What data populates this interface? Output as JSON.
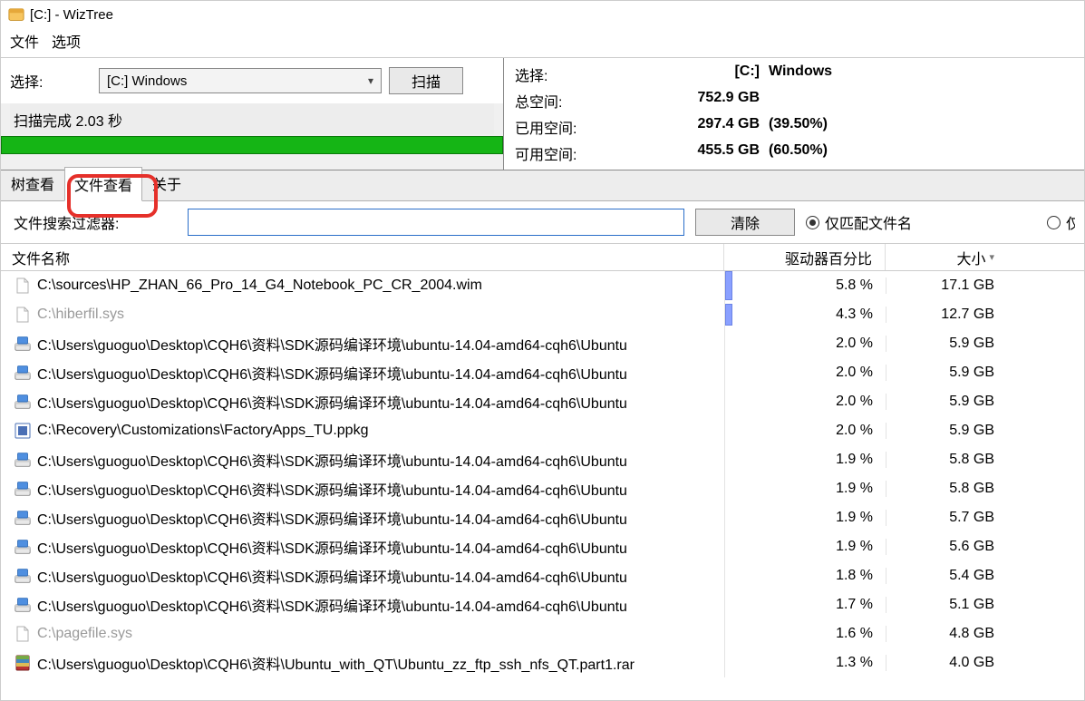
{
  "title": "[C:]  - WizTree",
  "menu": {
    "file": "文件",
    "options": "选项"
  },
  "left": {
    "select_label": "选择:",
    "drive": "[C:] Windows",
    "scan": "扫描",
    "status": "扫描完成 2.03 秒"
  },
  "info": {
    "select_label": "选择:",
    "drive_id": "[C:]",
    "drive_name": "Windows",
    "total_label": "总空间:",
    "total": "752.9 GB",
    "used_label": "已用空间:",
    "used": "297.4 GB",
    "used_pct": "(39.50%)",
    "free_label": "可用空间:",
    "free": "455.5 GB",
    "free_pct": "(60.50%)"
  },
  "tabs": {
    "tree": "树查看",
    "file": "文件查看",
    "about": "关于"
  },
  "filter": {
    "label": "文件搜索过滤器:",
    "value": "",
    "clear": "清除",
    "match_name": "仅匹配文件名"
  },
  "columns": {
    "name": "文件名称",
    "pct": "驱动器百分比",
    "size": "大小"
  },
  "rows": [
    {
      "icon": "file",
      "dim": false,
      "name": "C:\\sources\\HP_ZHAN_66_Pro_14_G4_Notebook_PC_CR_2004.wim",
      "pct": "5.8 %",
      "bar": 58,
      "size": "17.1 GB"
    },
    {
      "icon": "file",
      "dim": true,
      "name": "C:\\hiberfil.sys",
      "pct": "4.3 %",
      "bar": 43,
      "size": "12.7 GB"
    },
    {
      "icon": "disk",
      "dim": false,
      "name": "C:\\Users\\guoguo\\Desktop\\CQH6\\资料\\SDK源码编译环境\\ubuntu-14.04-amd64-cqh6\\Ubuntu",
      "pct": "2.0 %",
      "bar": 0,
      "size": "5.9 GB"
    },
    {
      "icon": "disk",
      "dim": false,
      "name": "C:\\Users\\guoguo\\Desktop\\CQH6\\资料\\SDK源码编译环境\\ubuntu-14.04-amd64-cqh6\\Ubuntu",
      "pct": "2.0 %",
      "bar": 0,
      "size": "5.9 GB"
    },
    {
      "icon": "disk",
      "dim": false,
      "name": "C:\\Users\\guoguo\\Desktop\\CQH6\\资料\\SDK源码编译环境\\ubuntu-14.04-amd64-cqh6\\Ubuntu",
      "pct": "2.0 %",
      "bar": 0,
      "size": "5.9 GB"
    },
    {
      "icon": "ppkg",
      "dim": false,
      "name": "C:\\Recovery\\Customizations\\FactoryApps_TU.ppkg",
      "pct": "2.0 %",
      "bar": 0,
      "size": "5.9 GB"
    },
    {
      "icon": "disk",
      "dim": false,
      "name": "C:\\Users\\guoguo\\Desktop\\CQH6\\资料\\SDK源码编译环境\\ubuntu-14.04-amd64-cqh6\\Ubuntu",
      "pct": "1.9 %",
      "bar": 0,
      "size": "5.8 GB"
    },
    {
      "icon": "disk",
      "dim": false,
      "name": "C:\\Users\\guoguo\\Desktop\\CQH6\\资料\\SDK源码编译环境\\ubuntu-14.04-amd64-cqh6\\Ubuntu",
      "pct": "1.9 %",
      "bar": 0,
      "size": "5.8 GB"
    },
    {
      "icon": "disk",
      "dim": false,
      "name": "C:\\Users\\guoguo\\Desktop\\CQH6\\资料\\SDK源码编译环境\\ubuntu-14.04-amd64-cqh6\\Ubuntu",
      "pct": "1.9 %",
      "bar": 0,
      "size": "5.7 GB"
    },
    {
      "icon": "disk",
      "dim": false,
      "name": "C:\\Users\\guoguo\\Desktop\\CQH6\\资料\\SDK源码编译环境\\ubuntu-14.04-amd64-cqh6\\Ubuntu",
      "pct": "1.9 %",
      "bar": 0,
      "size": "5.6 GB"
    },
    {
      "icon": "disk",
      "dim": false,
      "name": "C:\\Users\\guoguo\\Desktop\\CQH6\\资料\\SDK源码编译环境\\ubuntu-14.04-amd64-cqh6\\Ubuntu",
      "pct": "1.8 %",
      "bar": 0,
      "size": "5.4 GB"
    },
    {
      "icon": "disk",
      "dim": false,
      "name": "C:\\Users\\guoguo\\Desktop\\CQH6\\资料\\SDK源码编译环境\\ubuntu-14.04-amd64-cqh6\\Ubuntu",
      "pct": "1.7 %",
      "bar": 0,
      "size": "5.1 GB"
    },
    {
      "icon": "file",
      "dim": true,
      "name": "C:\\pagefile.sys",
      "pct": "1.6 %",
      "bar": 0,
      "size": "4.8 GB"
    },
    {
      "icon": "rar",
      "dim": false,
      "name": "C:\\Users\\guoguo\\Desktop\\CQH6\\资料\\Ubuntu_with_QT\\Ubuntu_zz_ftp_ssh_nfs_QT.part1.rar",
      "pct": "1.3 %",
      "bar": 0,
      "size": "4.0 GB"
    }
  ]
}
